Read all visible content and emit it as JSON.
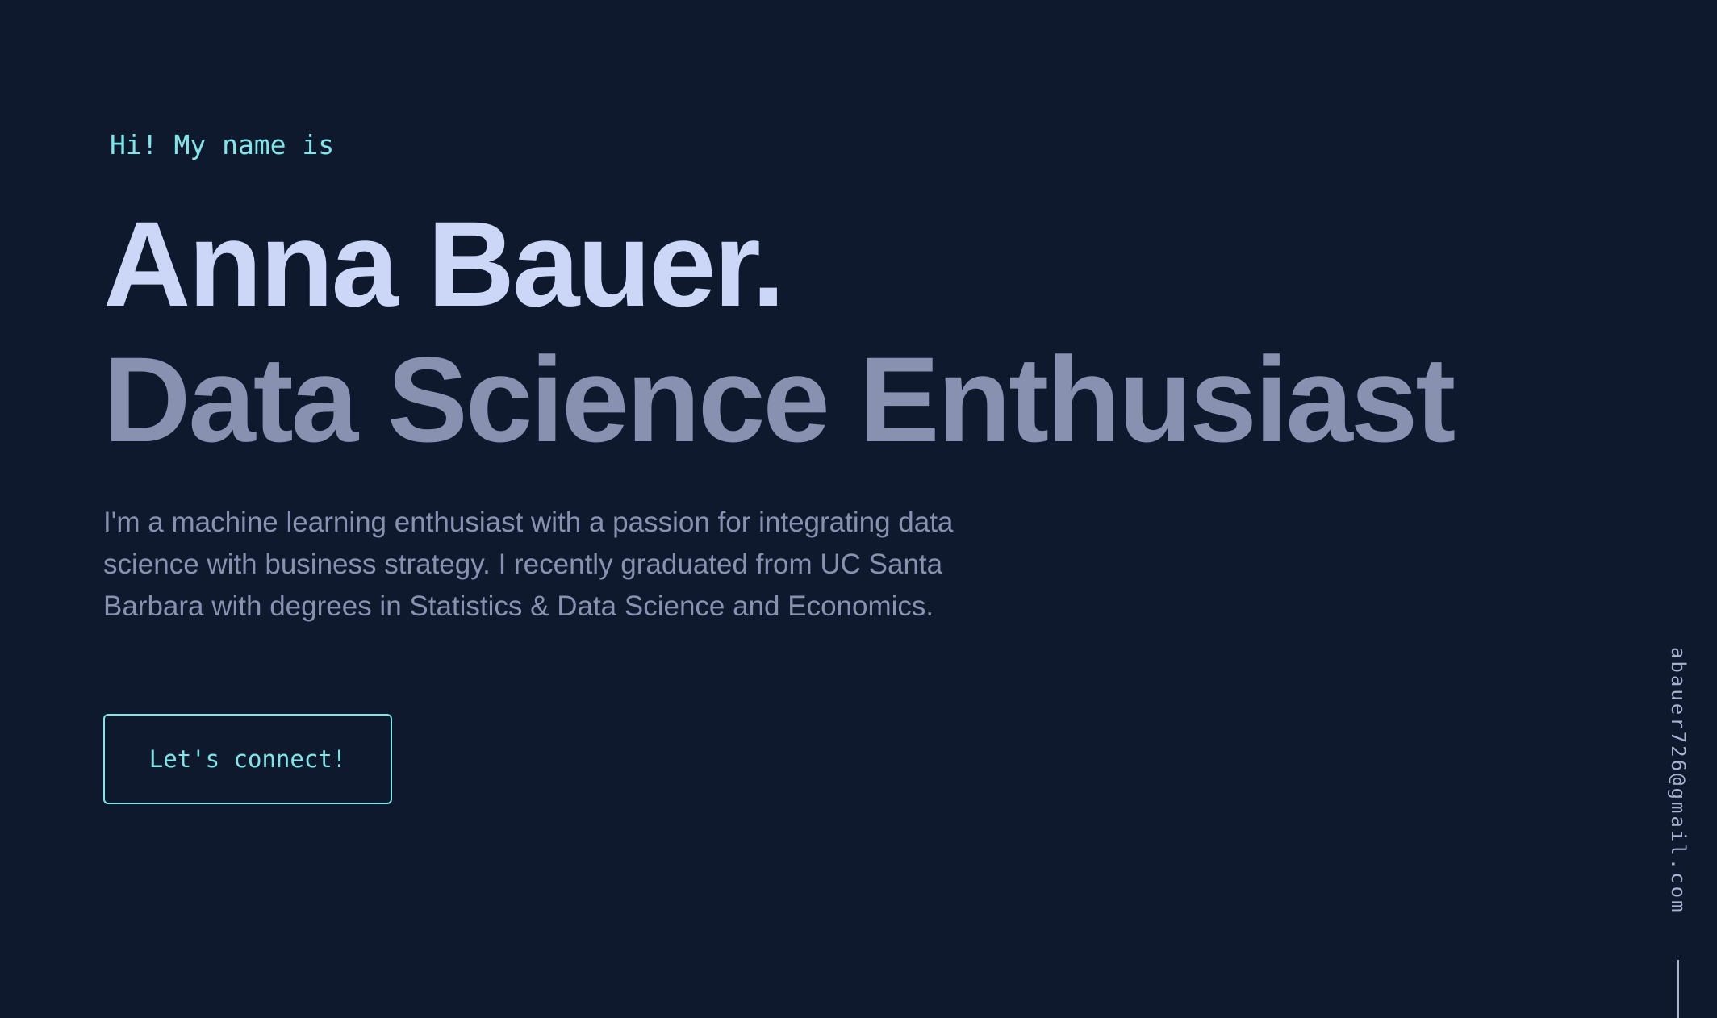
{
  "hero": {
    "greeting": "Hi! My name is",
    "name": "Anna Bauer.",
    "tagline": "Data Science Enthusiast",
    "bio": "I'm a machine learning enthusiast with a passion for integrating data science with business strategy. I recently graduated from UC Santa Barbara with degrees in Statistics & Data Science and Economics.",
    "cta_label": "Let's connect!"
  },
  "side": {
    "email": "abauer726@gmail.com"
  },
  "colors": {
    "background": "#0e192d",
    "accent": "#7fe6e8",
    "heading": "#ccd6f6",
    "subheading": "#8891b0",
    "body_text": "#8892b0"
  }
}
